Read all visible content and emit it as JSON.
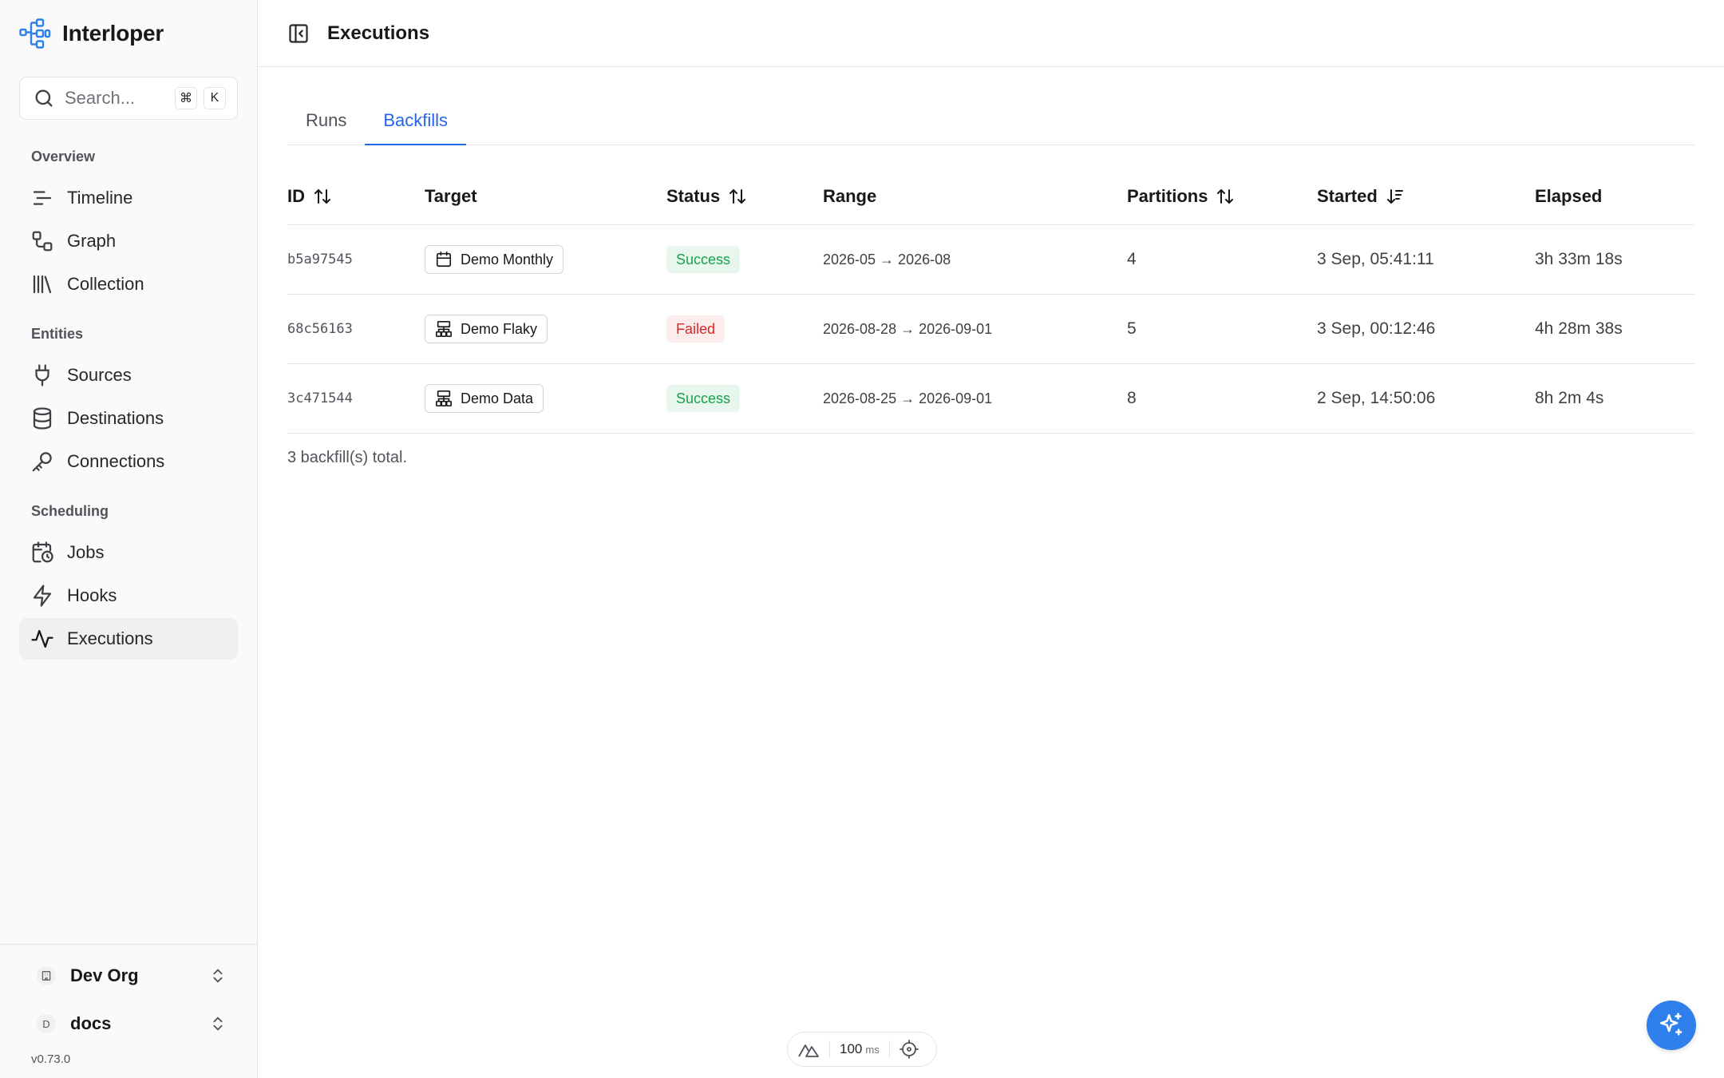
{
  "app": {
    "name": "Interloper",
    "version": "v0.73.0"
  },
  "search": {
    "placeholder": "Search...",
    "shortcut_keys": [
      "⌘",
      "K"
    ]
  },
  "sidebar": {
    "sections": [
      {
        "label": "Overview",
        "items": [
          {
            "label": "Timeline",
            "icon": "timeline-icon"
          },
          {
            "label": "Graph",
            "icon": "graph-icon"
          },
          {
            "label": "Collection",
            "icon": "library-icon"
          }
        ]
      },
      {
        "label": "Entities",
        "items": [
          {
            "label": "Sources",
            "icon": "plug-icon"
          },
          {
            "label": "Destinations",
            "icon": "database-icon"
          },
          {
            "label": "Connections",
            "icon": "key-icon"
          }
        ]
      },
      {
        "label": "Scheduling",
        "items": [
          {
            "label": "Jobs",
            "icon": "calendar-clock-icon"
          },
          {
            "label": "Hooks",
            "icon": "zap-icon"
          },
          {
            "label": "Executions",
            "icon": "activity-icon",
            "active": true
          }
        ]
      }
    ],
    "org": {
      "label": "Dev Org"
    },
    "workspace": {
      "label": "docs",
      "initial": "D"
    }
  },
  "header": {
    "title": "Executions"
  },
  "tabs": [
    {
      "label": "Runs",
      "active": false
    },
    {
      "label": "Backfills",
      "active": true
    }
  ],
  "table": {
    "columns": [
      {
        "label": "ID",
        "sort": "both"
      },
      {
        "label": "Target"
      },
      {
        "label": "Status",
        "sort": "both"
      },
      {
        "label": "Range"
      },
      {
        "label": "Partitions",
        "sort": "both"
      },
      {
        "label": "Started",
        "sort": "desc"
      },
      {
        "label": "Elapsed"
      }
    ],
    "rows": [
      {
        "id": "b5a97545",
        "target": "Demo Monthly",
        "target_icon": "calendar-icon",
        "status": "Success",
        "range": "2026-05 → 2026-08",
        "partitions": "4",
        "started": "3 Sep, 05:41:11",
        "elapsed": "3h 33m 18s"
      },
      {
        "id": "68c56163",
        "target": "Demo Flaky",
        "target_icon": "network-icon",
        "status": "Failed",
        "range": "2026-08-28 → 2026-09-01",
        "partitions": "5",
        "started": "3 Sep, 00:12:46",
        "elapsed": "4h 28m 38s"
      },
      {
        "id": "3c471544",
        "target": "Demo Data",
        "target_icon": "network-icon",
        "status": "Success",
        "range": "2026-08-25 → 2026-09-01",
        "partitions": "8",
        "started": "2 Sep, 14:50:06",
        "elapsed": "8h 2m 4s"
      }
    ],
    "total_text": "3 backfill(s) total."
  },
  "devtools": {
    "value": "100",
    "unit": "ms"
  },
  "colors": {
    "accent": "#2563eb",
    "success": "#16a34a",
    "failed": "#dc2626",
    "fab": "#2f80ed"
  }
}
